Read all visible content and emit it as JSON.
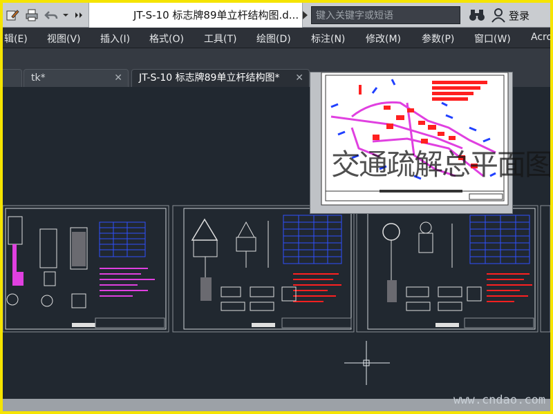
{
  "window": {
    "document_title": "JT-S-10 标志牌89单立杆结构图.d...",
    "search_placeholder": "键入关键字或短语",
    "login_label": "登录"
  },
  "menu": {
    "items": [
      "辑(E)",
      "视图(V)",
      "插入(I)",
      "格式(O)",
      "工具(T)",
      "绘图(D)",
      "标注(N)",
      "修改(M)",
      "参数(P)",
      "窗口(W)",
      "Acro"
    ]
  },
  "tabs": [
    {
      "label": "tk*",
      "active": false
    },
    {
      "label": "JT-S-10 标志牌89单立杆结构图*",
      "active": true
    }
  ],
  "preview": {
    "caption": "交通疏解总平面图"
  },
  "watermark": "www.cndao.com",
  "colors": {
    "accent_border": "#f5e400",
    "canvas_bg": "#212830",
    "drawing_magenta": "#e040e0",
    "drawing_red": "#ff2020",
    "drawing_blue": "#2040ff"
  }
}
